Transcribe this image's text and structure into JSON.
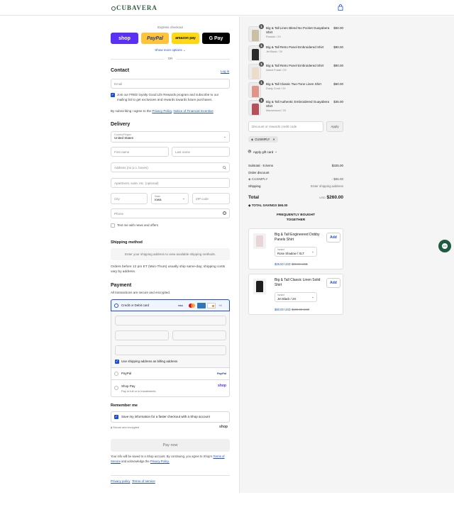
{
  "header": {
    "logo": "CUBAVERA"
  },
  "express": {
    "label": "Express checkout",
    "shop": "shop",
    "paypal": "PayPal",
    "amazon": "amazon pay",
    "gpay": "G Pay",
    "more": "Show more options",
    "or": "OR"
  },
  "contact": {
    "title": "Contact",
    "login": "Log in",
    "email_placeholder": "Email",
    "rewards_text": "Join our FREE loyalty Good Life Rewards program and subscribe to our mailing list to get exclusives and rewards towards future purchases.",
    "agree_prefix": "By subscribing I agree to the",
    "privacy_link": "Privacy Policy",
    "sep": ",",
    "notice_link": "Notice of Financial Incentive"
  },
  "delivery": {
    "title": "Delivery",
    "country_label": "Country/Region",
    "country": "United States",
    "first": "First name",
    "last": "Last name",
    "address": "Address (no p.o. boxes)",
    "apt": "Apartment, suite, etc. (optional)",
    "city": "City",
    "state_label": "State",
    "state": "Iowa",
    "zip": "ZIP code",
    "phone": "Phone",
    "text_me": "Text me with news and offers"
  },
  "shipping": {
    "title": "Shipping method",
    "placeholder": "Enter your shipping address to view available shipping methods.",
    "note": "Orders before 12 pm ET (Mon-Thurs) usually ship same-day; shipping costs vary by address."
  },
  "payment": {
    "title": "Payment",
    "subtitle": "All transactions are secure and encrypted.",
    "card_label": "Credit or Debit card",
    "visa": "VISA",
    "more_cards": "+4",
    "billing": "Use shipping address as billing address",
    "paypal": "PayPal",
    "paypal_logo": "PayPal",
    "shoppay": "Shop Pay",
    "shoppay_sub": "Pay in full or in installments",
    "shoppay_logo": "shop"
  },
  "remember": {
    "title": "Remember me",
    "save": "Save my information for a faster checkout with a Shop account",
    "secure": "Secure and encrypted",
    "shop_logo": "shop"
  },
  "paynow": "Pay now",
  "legal": {
    "text": "Your info will be saved to a Shop account. By continuing, you agree to Shop's",
    "tos": "Terms of Service",
    "and": "and acknowledge the",
    "privacy": "Privacy Policy."
  },
  "footer": {
    "privacy": "Privacy policy",
    "terms": "Terms of service"
  },
  "cart": {
    "items": [
      {
        "qty": "1",
        "name": "Big & Tall Linen Blend No Pocket Guayabera Shirt",
        "variant": "Rosado / 2X",
        "price": "$50.00",
        "color": "#c9c1a3"
      },
      {
        "qty": "1",
        "name": "Big & Tall Retro Panel Embroidered Shirt",
        "variant": "Jet Black / 2X",
        "price": "$90.00",
        "color": "#2b2b2b"
      },
      {
        "qty": "1",
        "name": "Big & Tall Retro Panel Embroidered Shirt",
        "variant": "Island Fossil / 2X",
        "price": "$90.00",
        "color": "#ecdcc8"
      },
      {
        "qty": "1",
        "name": "Big & Tall Classic Two-Tone Linen Shirt",
        "variant": "Dusty Coral / 2X",
        "price": "$60.00",
        "color": "#e3948a"
      },
      {
        "qty": "1",
        "name": "Big & Tall Authentic Embroidered Guayabera Shirt",
        "variant": "Mauvewood / 2X",
        "price": "$35.00",
        "color": "#b8505c"
      }
    ],
    "discount_placeholder": "Discount or rewards credit code",
    "apply": "Apply",
    "code": "CUSIMPLY",
    "gift": "Apply gift card",
    "subtotal_label": "Subtotal · 5 items",
    "subtotal": "$325.00",
    "order_discount": "Order discount",
    "discount_code": "CUSIMPLY",
    "discount_value": "- $65.00",
    "shipping_label": "Shipping",
    "shipping_value": "Enter shipping address",
    "total_label": "Total",
    "currency": "USD",
    "total": "$260.00",
    "savings_label": "TOTAL SAVINGS",
    "savings": "$65.00"
  },
  "upsell": {
    "title_1": "FREQUENTLY BOUGHT",
    "title_2": "TOGETHER",
    "products": [
      {
        "name": "Big & Tall Engineered Dobby Panels Shirt",
        "variant_label": "Variant",
        "variant": "Rose Shadow / XLT",
        "price": "$29.50 USD",
        "compare": "$99.00 USD",
        "add": "Add",
        "color": "#e8d6d6"
      },
      {
        "name": "Big & Tall Classic Linen Solid Shirt",
        "variant_label": "Variant",
        "variant": "Jet Black / 2X",
        "price": "$60.00 USD",
        "compare": "$100.00 USD",
        "add": "Add",
        "color": "#1e1e1e"
      }
    ]
  }
}
